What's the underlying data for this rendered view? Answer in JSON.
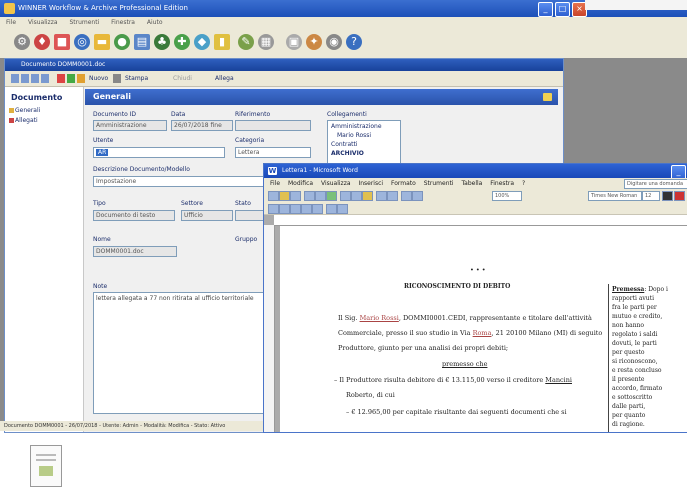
{
  "app": {
    "title": "WINNER Workflow & Archive Professional Edition",
    "menu": [
      "File",
      "Visualizza",
      "Strumenti",
      "Finestra",
      "Aiuto"
    ]
  },
  "doc_window": {
    "title": "Documento DOMM0001.doc",
    "toolbar": {
      "new_label": "Nuovo",
      "print_label": "Stampa",
      "close_label": "Chiudi",
      "attach_label": "Allega"
    }
  },
  "sidebar": {
    "title": "Documento",
    "items": [
      {
        "label": "Generali"
      },
      {
        "label": "Allegati"
      }
    ]
  },
  "general": {
    "header": "Generali",
    "fields": {
      "doc_id_label": "Documento ID",
      "doc_id_value": "Amministrazione",
      "date_label": "Data",
      "date_value": "26/07/2018 fine",
      "ref_label": "Riferimento",
      "ref_value": "",
      "links_label": "Collegamenti",
      "owner_label": "Utente",
      "owner_value": "AR",
      "category_label": "Categoria",
      "category_value": "Lettera",
      "desc_label": "Descrizione Documento/Modello",
      "desc_value": "Impostazione",
      "type_label": "Tipo",
      "type_value": "Documento di testo",
      "sector_label": "Settore",
      "sector_value": "Ufficio",
      "status_label": "Stato",
      "name_label": "Nome",
      "name_value": "DOMM0001.doc",
      "group_label": "Gruppo",
      "note_label": "Note",
      "note_value": "lettera allegata a 77 non ritirata al ufficio territoriale"
    },
    "tree": [
      "Amministrazione",
      "Mario Rossi",
      "Contratti",
      "ARCHIVIO"
    ]
  },
  "statusbar": {
    "text": "Documento DOMM0001 - 26/07/2018 - Utente: Admin - Modalità: Modifica - Stato: Attivo"
  },
  "word": {
    "title": "Lettera1 - Microsoft Word",
    "menu": [
      "File",
      "Modifica",
      "Visualizza",
      "Inserisci",
      "Formato",
      "Strumenti",
      "Tabella",
      "Finestra",
      "?"
    ],
    "search_placeholder": "Digitare una domanda",
    "font": "Times New Roman",
    "font_size": "12",
    "zoom": "100%",
    "doc": {
      "dots": "• • •",
      "heading": "RICONOSCIMENTO DI DEBITO",
      "p1a": "Il Sig.",
      "p1_name": "Mario Rossi",
      "p1b": ", DOMMI0001.CEDI, rappresentante e titolare dell'attività",
      "p2": "Commerciale, presso il suo studio in Via",
      "p2_link": "Roma",
      "p2b": ", 21 20100 Milano (MI) di seguito",
      "p3": "Produttore, giunto per una analisi dei propri debiti;",
      "subhead": "premesso che",
      "b1": "Il Produttore risulta debitore di € 13.115,00 verso il creditore",
      "b1_link": "Mancini",
      "b1b": "Roberto, di cui",
      "b2": "€ 12.965,00 per capitale risultante dai seguenti documenti che si"
    },
    "side_note": [
      {
        "label": "Premessa",
        "text": ": Dopo i"
      },
      {
        "text": "rapporti avuti"
      },
      {
        "text": "fra le parti per"
      },
      {
        "text": "mutuo e credito,"
      },
      {
        "text": "non hanno"
      },
      {
        "text": "regolato i saldi"
      },
      {
        "text": "dovuti, le parti"
      },
      {
        "text": "per questo"
      },
      {
        "text": "si riconoscono,"
      },
      {
        "text": "e resta concluso"
      },
      {
        "text": "il presente"
      },
      {
        "text": "accordo, firmato"
      },
      {
        "text": "e sottoscritto"
      },
      {
        "text": "dalle parti,"
      },
      {
        "text": "per quanto"
      },
      {
        "text": "di ragione."
      }
    ]
  }
}
